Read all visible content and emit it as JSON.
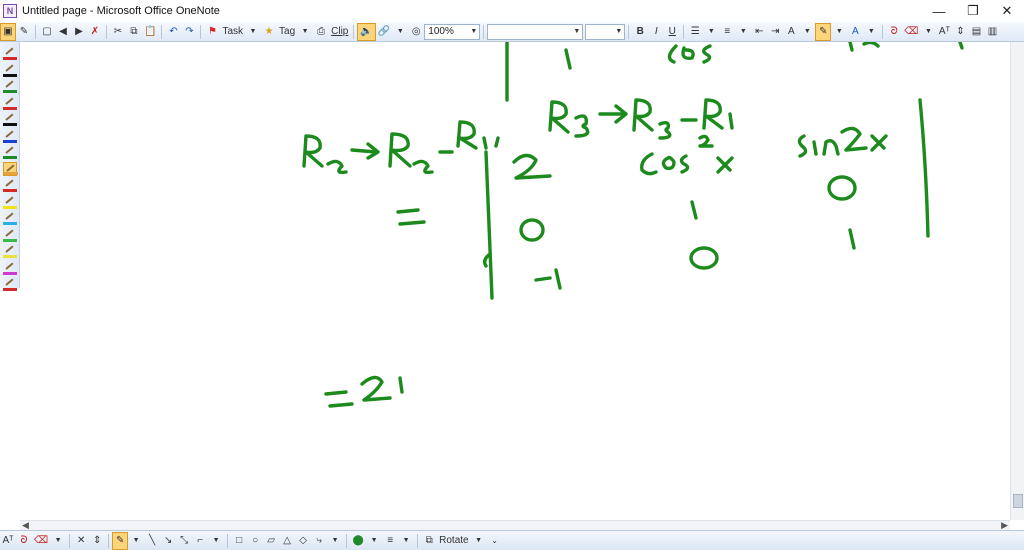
{
  "window": {
    "title": "Untitled page - Microsoft Office OneNote",
    "app_icon_letter": "N",
    "minimize": "—",
    "maximize": "❐",
    "close": "✕"
  },
  "toolbar": {
    "task_label": "Task",
    "tag_label": "Tag",
    "clip_label": "Clip",
    "zoom_value": "100%",
    "font_value": "",
    "size_value": "",
    "bold": "B",
    "italic": "I",
    "underline": "U"
  },
  "pens": [
    {
      "color": "#d62a2a"
    },
    {
      "color": "#111111"
    },
    {
      "color": "#1f8a2a"
    },
    {
      "color": "#d62a2a"
    },
    {
      "color": "#111111"
    },
    {
      "color": "#1a3fd6"
    },
    {
      "color": "#1f8a2a"
    },
    {
      "color": "#e8a23a"
    },
    {
      "color": "#d62a2a"
    },
    {
      "color": "#f2e21a"
    },
    {
      "color": "#28b0e0"
    },
    {
      "color": "#3ab84a"
    },
    {
      "color": "#e8e23a"
    },
    {
      "color": "#d03ad0"
    },
    {
      "color": "#d62a2a"
    }
  ],
  "ink": {
    "color": "#1d8a1d",
    "row_op_1": "R₂→R₂−R₁ ,",
    "row_op_2": "R₃→R₃−R₁",
    "top_partial_1": "Cos x",
    "equals_1": "=",
    "matrix": [
      [
        "2",
        "cos² x",
        "sin 2x"
      ],
      [
        "0",
        "1",
        "0"
      ],
      [
        "-1",
        "0",
        "1"
      ]
    ],
    "equals_2": "= 2 ·"
  },
  "drawbar": {
    "rotate_label": "Rotate"
  }
}
